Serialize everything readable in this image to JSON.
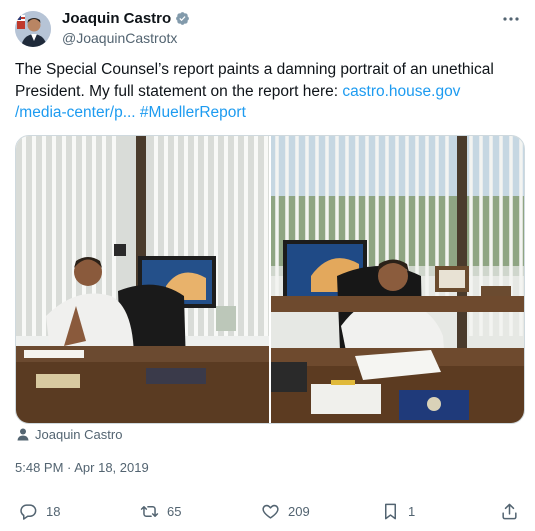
{
  "author": {
    "display_name": "Joaquin Castro",
    "handle": "@JoaquinCastrotx",
    "verified_icon": "verified-badge-icon"
  },
  "tweet": {
    "text_main": "The Special Counsel’s report paints a damning portrait of an unethical President. My full statement on the report here: ",
    "link_text": "castro.house.gov\n/media-center/p...",
    "hashtag": "#MuellerReport",
    "photo_credit": "Joaquin Castro",
    "timestamp": "5:48 PM · Apr 18, 2019"
  },
  "actions": {
    "replies": "18",
    "retweets": "65",
    "likes": "209",
    "bookmarks": "1"
  },
  "colors": {
    "link": "#1d9bf0",
    "secondary_text": "#536471",
    "verified": "#829aab"
  }
}
